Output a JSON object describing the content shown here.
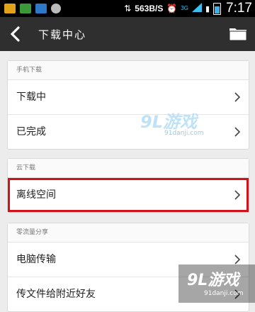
{
  "status_bar": {
    "speed": "563B/S",
    "network": "3G",
    "time": "7:17"
  },
  "title_bar": {
    "title": "下载中心"
  },
  "sections": [
    {
      "header": "手机下载",
      "rows": [
        "下载中",
        "已完成"
      ]
    },
    {
      "header": "云下载",
      "rows": [
        "离线空间"
      ]
    },
    {
      "header": "零流量分享",
      "rows": [
        "电脑传输",
        "传文件给附近好友"
      ]
    }
  ],
  "watermark": {
    "brand": "9L游戏",
    "site": "91danji.com"
  },
  "colors": {
    "title_bar_bg": "#2f2f2f",
    "highlight_border": "#d0121b",
    "page_bg": "#ececec"
  }
}
